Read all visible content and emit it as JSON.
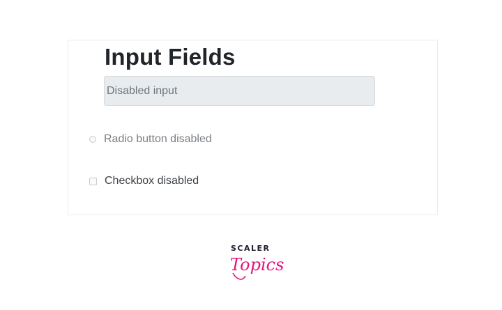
{
  "form": {
    "title": "Input Fields",
    "input_placeholder": "Disabled input",
    "radio_label": "Radio button disabled",
    "checkbox_label": "Checkbox disabled"
  },
  "brand": {
    "top_text": "SCALER",
    "script_text": "Topics",
    "accent_color": "#e3137d",
    "dark_color": "#1e1e2e"
  }
}
